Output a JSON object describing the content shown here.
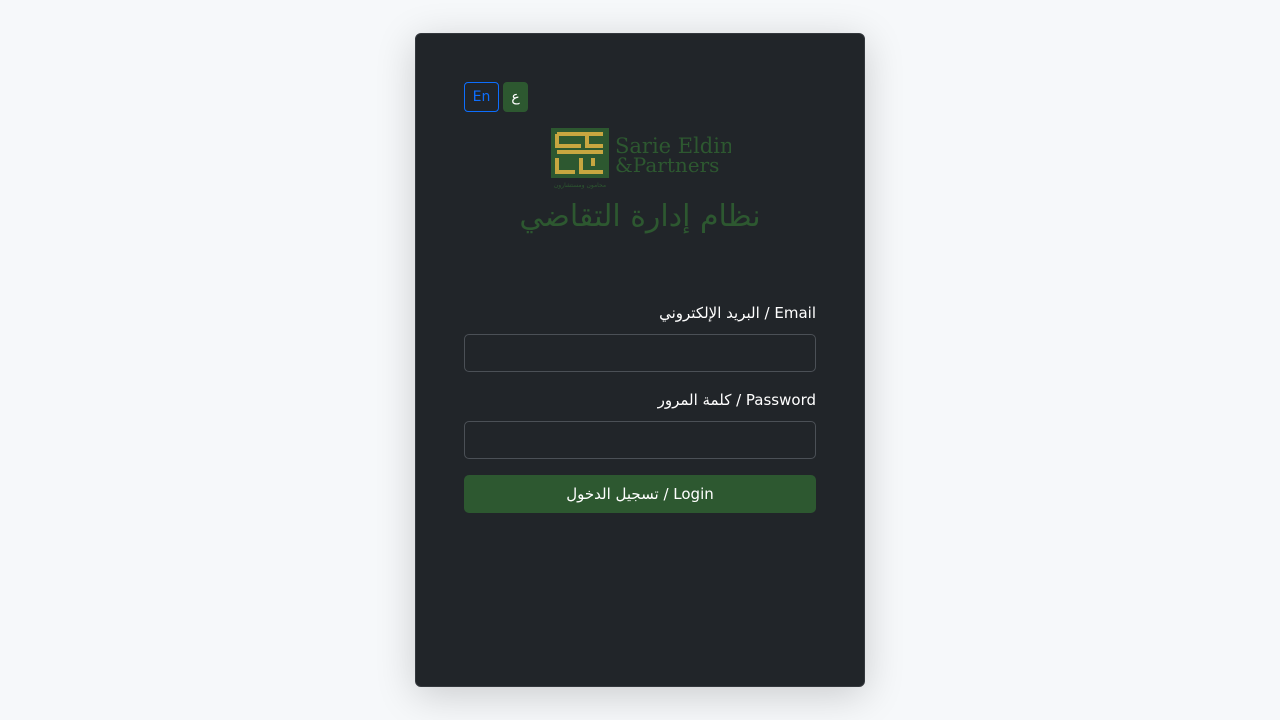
{
  "language_switcher": {
    "en_label": "En",
    "ar_label": "ع"
  },
  "logo": {
    "brand_line1": "Sarie Eldin",
    "brand_line2": "&Partners",
    "tagline": "محامون ومستشارون"
  },
  "page_title": "نظام إدارة التقاضي",
  "form": {
    "email_label": "البريد الإلكتروني / Email",
    "email_value": "",
    "password_label": "كلمة المرور / Password",
    "password_value": "",
    "submit_label": "تسجيل الدخول / Login"
  },
  "colors": {
    "brand_green": "#2d5830",
    "logo_gold": "#c7a640",
    "card_bg": "#212529",
    "page_bg": "#f6f8fa",
    "en_blue": "#0d6efd"
  }
}
